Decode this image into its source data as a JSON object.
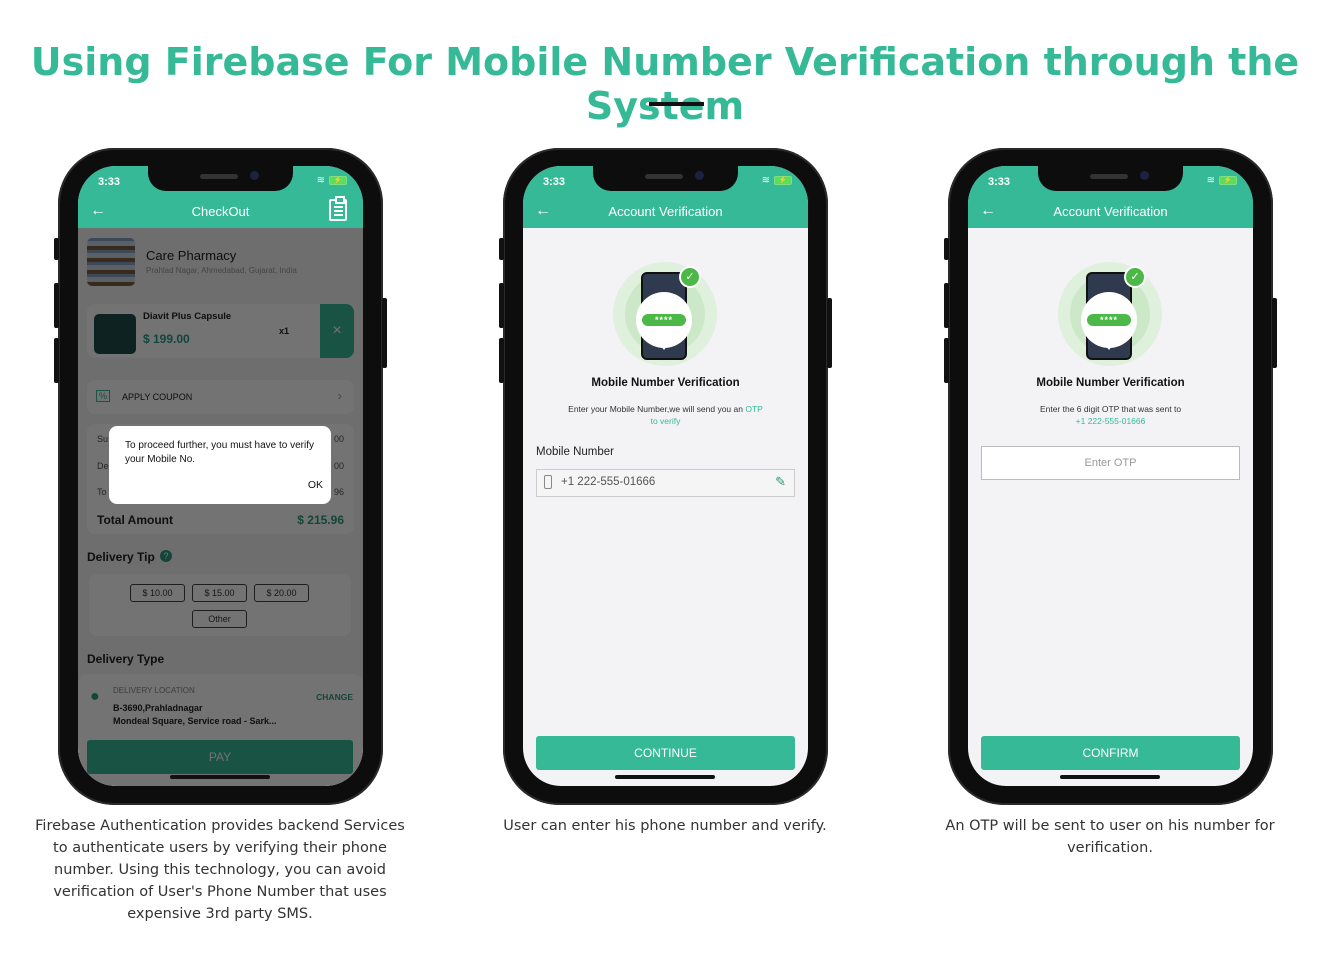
{
  "header": {
    "title": "Using Firebase For Mobile Number Verification through the System"
  },
  "phones": [
    {
      "status_time": "3:33",
      "appbar_title": "CheckOut",
      "store": {
        "name": "Care Pharmacy",
        "address": "Prahlad Nagar, Ahmedabad, Gujarat, India"
      },
      "cart_item": {
        "name": "Diavit Plus Capsule",
        "price": "$ 199.00",
        "qty": "x1",
        "remove": "×"
      },
      "coupon": {
        "label": "APPLY COUPON",
        "chevron": "›"
      },
      "summary": {
        "rows": [
          {
            "label": "Su",
            "value": "00"
          },
          {
            "label": "De",
            "value": "00"
          },
          {
            "label": "To",
            "value": "96"
          }
        ],
        "total_label": "Total Amount",
        "total_value": "$ 215.96"
      },
      "dialog": {
        "message": "To proceed further, you must have to verify your Mobile No.",
        "ok": "OK"
      },
      "delivery_tip": {
        "title": "Delivery Tip",
        "help": "?",
        "options": [
          "$ 10.00",
          "$ 15.00",
          "$ 20.00",
          "Other"
        ]
      },
      "delivery_type": {
        "title": "Delivery Type"
      },
      "delivery_location": {
        "label": "DELIVERY LOCATION",
        "change": "CHANGE",
        "line1": "B-3690,Prahladnagar",
        "line2": "Mondeal Square, Service road - Sark..."
      },
      "pay_label": "PAY"
    },
    {
      "status_time": "3:33",
      "appbar_title": "Account Verification",
      "illustration_code": "****",
      "heading": "Mobile Number  Verification",
      "instruction": "Enter your Mobile Number,we will send you an",
      "instruction_highlight": "OTP",
      "instruction_highlight2": "to verify",
      "field_label": "Mobile Number",
      "phone_value": "+1 222-555-01666",
      "button_label": "CONTINUE"
    },
    {
      "status_time": "3:33",
      "appbar_title": "Account Verification",
      "illustration_code": "****",
      "heading": "Mobile Number  Verification",
      "instruction": "Enter the 6 digit OTP that was sent to",
      "instruction_highlight": "+1 222-555-01666",
      "otp_placeholder": "Enter OTP",
      "button_label": "CONFIRM"
    }
  ],
  "captions": [
    "Firebase Authentication provides backend Services to authenticate users by verifying their phone number. Using this technology, you can avoid verification of User's Phone Number that uses expensive 3rd party SMS.",
    "User can enter his phone number and verify.",
    "An OTP will be sent to user on his number for verification."
  ],
  "colors": {
    "brand": "#35b997",
    "illustration_green": "#4cb848"
  }
}
